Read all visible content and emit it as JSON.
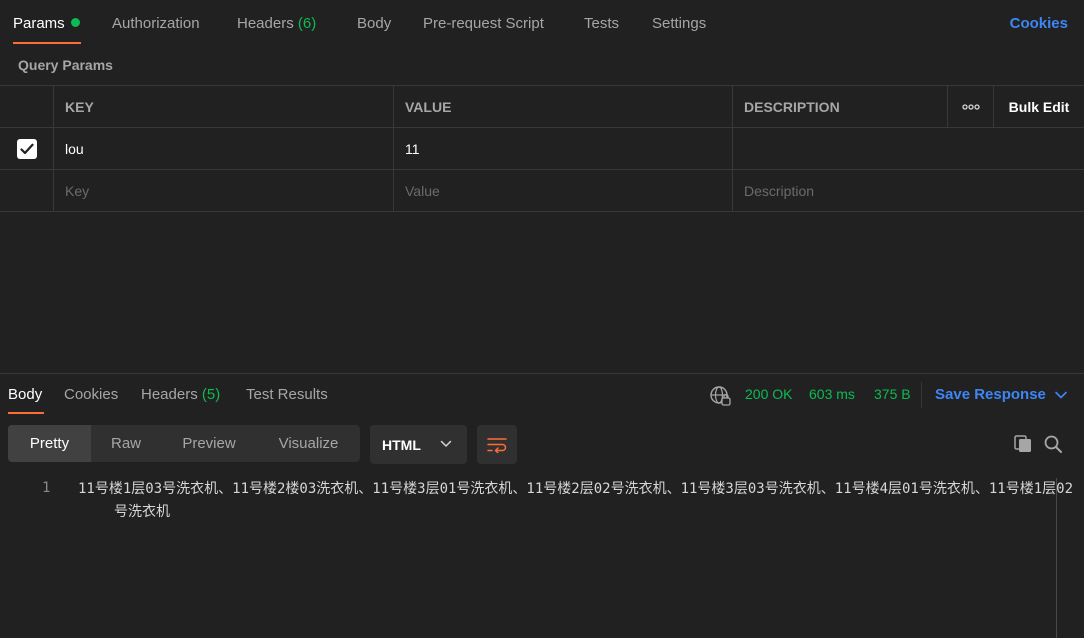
{
  "request_tabs": [
    {
      "label": "Params",
      "dot": true
    },
    {
      "label": "Authorization"
    },
    {
      "label": "Headers",
      "count": "(6)"
    },
    {
      "label": "Body"
    },
    {
      "label": "Pre-request Script"
    },
    {
      "label": "Tests"
    },
    {
      "label": "Settings"
    }
  ],
  "cookies_label": "Cookies",
  "query_params": {
    "title": "Query Params",
    "headers": {
      "key": "KEY",
      "value": "VALUE",
      "description": "DESCRIPTION",
      "bulk_edit": "Bulk Edit"
    },
    "rows": [
      {
        "checked": true,
        "key": "lou",
        "value": "11",
        "description": ""
      }
    ],
    "placeholders": {
      "key": "Key",
      "value": "Value",
      "description": "Description"
    }
  },
  "response": {
    "tabs": [
      {
        "label": "Body"
      },
      {
        "label": "Cookies"
      },
      {
        "label": "Headers",
        "count": "(5)"
      },
      {
        "label": "Test Results"
      }
    ],
    "status": "200 OK",
    "time": "603 ms",
    "size": "375 B",
    "save_label": "Save Response",
    "views": [
      "Pretty",
      "Raw",
      "Preview",
      "Visualize"
    ],
    "format": "HTML",
    "line_number": "1",
    "body": "11号楼1层03号洗衣机、11号楼2楼03洗衣机、11号楼3层01号洗衣机、11号楼2层02号洗衣机、11号楼3层03号洗衣机、11号楼4层01号洗衣机、11号楼1层02号洗衣机"
  },
  "colors": {
    "accent_orange": "#ff6c37",
    "success_green": "#0cbb52",
    "link_blue": "#3d86f5",
    "background": "#212121"
  }
}
